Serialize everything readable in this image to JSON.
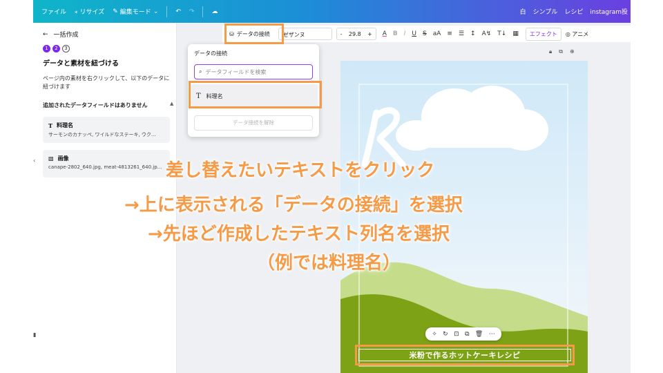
{
  "topbar": {
    "file": "ファイル",
    "resize": "リサイズ",
    "edit_mode": "編集モード",
    "right_items": [
      "白",
      "シンプル",
      "レシピ",
      "instagram投"
    ]
  },
  "left_panel": {
    "back_label": "一括作成",
    "steps": [
      "1",
      "2",
      "3"
    ],
    "heading": "データと素材を紐づける",
    "description": "ページ内の素材を右クリックして、以下のデータに紐づけます",
    "no_fields": "追加されたデータフィールドはありません",
    "fields": [
      {
        "name": "料理名",
        "sample": "サーモンのカナッペ, ワイルドなステーキ, ウク..."
      },
      {
        "name": "画像",
        "sample": "canape-2802_640.jpg, meat-4813261_640.jp..."
      }
    ]
  },
  "toolbar": {
    "data_connect": "データの接続",
    "font": "ゼザンヌ",
    "size_minus": "-",
    "size": "29.8",
    "size_plus": "+",
    "effect": "エフェクト",
    "animate": "アニメ"
  },
  "dropdown": {
    "title": "データの接続",
    "search_placeholder": "データフィールドを検索",
    "item": "料理名",
    "disconnect": "データ接続を解除"
  },
  "canvas": {
    "recipe_title": "米粉で作るホットケーキレシピ"
  },
  "instructions": [
    "差し替えたいテキストをクリック",
    "→上に表示される「データの接続」を選択",
    "→先ほど作成したテキスト列名を選択",
    "（例では料理名）"
  ],
  "colors": {
    "highlight": "#f59a47",
    "accent": "#7d2ae8",
    "grass": "#7ea216",
    "sky": "#cfe8f8"
  }
}
